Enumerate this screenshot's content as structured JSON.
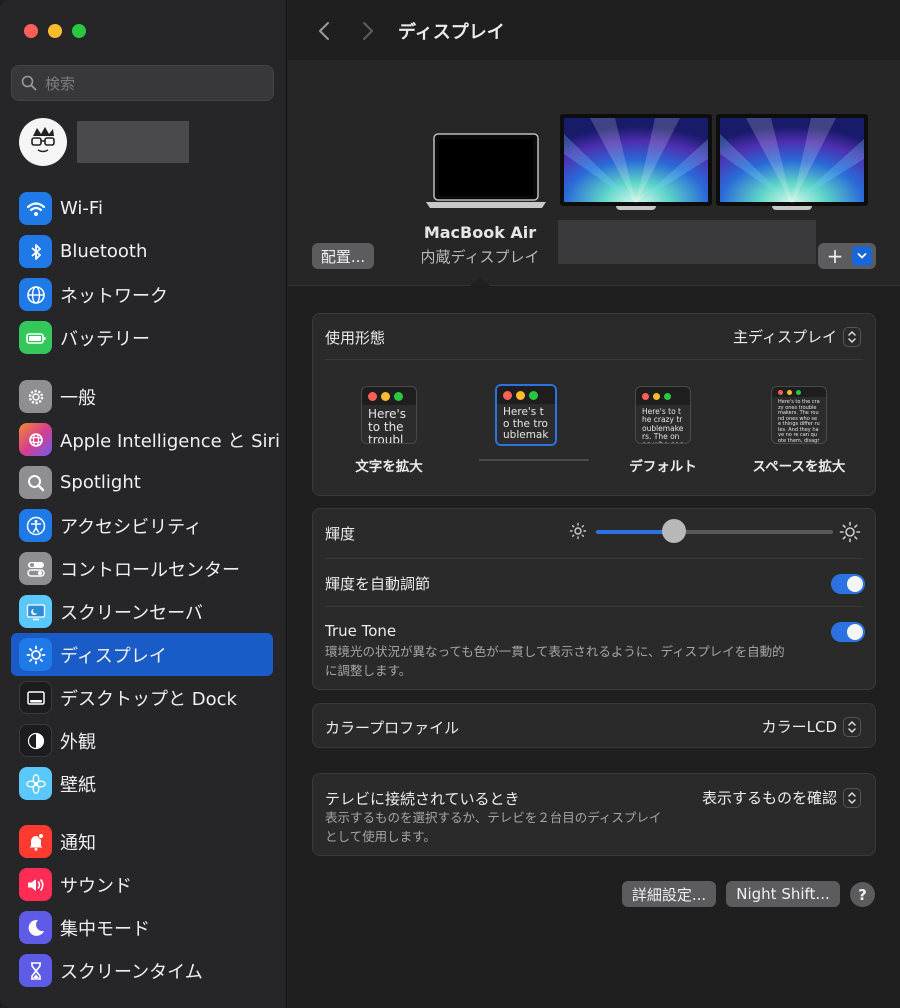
{
  "sidebar": {
    "search_placeholder": "検索",
    "groups": [
      [
        {
          "label": "Wi-Fi",
          "icon": "wifi-icon",
          "color": "#1f7ae8"
        },
        {
          "label": "Bluetooth",
          "icon": "bluetooth-icon",
          "color": "#1f7ae8"
        },
        {
          "label": "ネットワーク",
          "icon": "globe-icon",
          "color": "#1f7ae8"
        },
        {
          "label": "バッテリー",
          "icon": "battery-icon",
          "color": "#34c759"
        }
      ],
      [
        {
          "label": "一般",
          "icon": "gear-icon",
          "color": "#8e8e93"
        },
        {
          "label": "Apple Intelligence と Siri",
          "icon": "siri-icon",
          "color": "#c447d9"
        },
        {
          "label": "Spotlight",
          "icon": "magnifier-icon",
          "color": "#8e8e93"
        },
        {
          "label": "アクセシビリティ",
          "icon": "accessibility-icon",
          "color": "#1f7ae8"
        },
        {
          "label": "コントロールセンター",
          "icon": "control-center-icon",
          "color": "#8e8e93"
        },
        {
          "label": "スクリーンセーバ",
          "icon": "screensaver-icon",
          "color": "#5ac8fa"
        },
        {
          "label": "ディスプレイ",
          "icon": "sun-icon",
          "color": "#1f7ae8",
          "active": true
        },
        {
          "label": "デスクトップと Dock",
          "icon": "dock-icon",
          "color": "#1c1c1e"
        },
        {
          "label": "外観",
          "icon": "appearance-icon",
          "color": "#1c1c1e"
        },
        {
          "label": "壁紙",
          "icon": "flower-icon",
          "color": "#5ac8fa"
        }
      ],
      [
        {
          "label": "通知",
          "icon": "bell-icon",
          "color": "#ff3b30"
        },
        {
          "label": "サウンド",
          "icon": "speaker-icon",
          "color": "#ff2d55"
        },
        {
          "label": "集中モード",
          "icon": "moon-icon",
          "color": "#5e5ce6"
        },
        {
          "label": "スクリーンタイム",
          "icon": "hourglass-icon",
          "color": "#5e5ce6"
        }
      ]
    ]
  },
  "header": {
    "title": "ディスプレイ"
  },
  "arrangement": {
    "display_name": "MacBook Air",
    "display_sub": "内蔵ディスプレイ",
    "arrange_button": "配置...",
    "add_button": "+"
  },
  "usage": {
    "label": "使用形態",
    "value": "主ディスプレイ",
    "options": [
      {
        "label": "文字を拡大",
        "sample": "Here's to the troublemakers"
      },
      {
        "label": "",
        "sample": "Here's to the troublemakers ones who"
      },
      {
        "label": "デフォルト",
        "sample": "Here's to the crazy troublemakers. The ones who see things rules. And they have"
      },
      {
        "label": "スペースを拡大",
        "sample": "Here's to the crazy ones troublemakers. The round ones who see things differ rules. And they have no re can quote them, disagree them. About the only thing Because they change thing"
      }
    ]
  },
  "brightness": {
    "label": "輝度",
    "level": 0.33
  },
  "auto_brightness": {
    "label": "輝度を自動調節",
    "on": true
  },
  "true_tone": {
    "label": "True Tone",
    "description_line1": "環境光の状況が異なっても色が一貫して表示されるように、ディスプレイを自動的",
    "description_line2": "に調整します。",
    "on": true
  },
  "color_profile": {
    "label": "カラープロファイル",
    "value": "カラーLCD"
  },
  "tv": {
    "label": "テレビに接続されているとき",
    "value": "表示するものを確認",
    "description_line1": "表示するものを選択するか、テレビを２台目のディスプレイ",
    "description_line2": "として使用します。"
  },
  "footer": {
    "advanced": "詳細設定...",
    "night_shift": "Night Shift...",
    "help": "?"
  }
}
